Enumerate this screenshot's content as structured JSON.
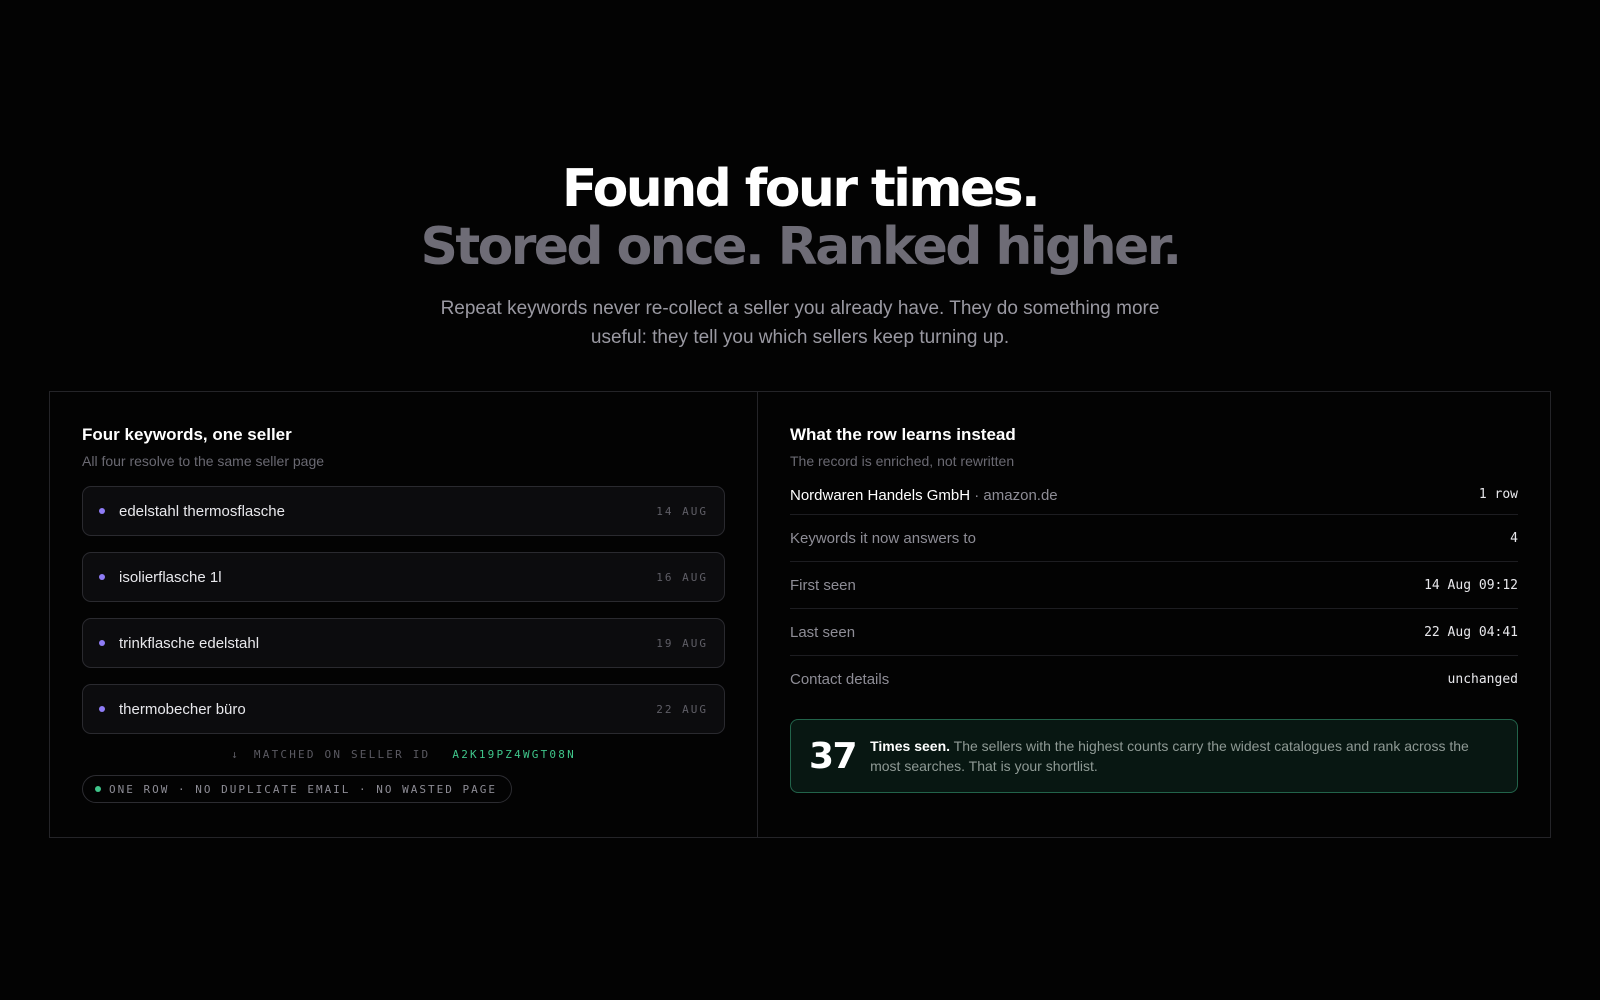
{
  "hero": {
    "headline_line1": "Found four times.",
    "headline_line2": "Stored once. Ranked higher.",
    "subtext": "Repeat keywords never re-collect a seller you already have. They do something more useful: they tell you which sellers keep turning up."
  },
  "left_panel": {
    "title": "Four keywords, one seller",
    "subtitle": "All four resolve to the same seller page",
    "keywords": [
      {
        "term": "edelstahl thermosflasche",
        "date": "14 AUG"
      },
      {
        "term": "isolierflasche 1l",
        "date": "16 AUG"
      },
      {
        "term": "trinkflasche edelstahl",
        "date": "19 AUG"
      },
      {
        "term": "thermobecher büro",
        "date": "22 AUG"
      }
    ],
    "matched_label": "MATCHED ON SELLER ID",
    "matched_arrow": "↓",
    "seller_id": "A2K19PZ4WGT08N",
    "summary_pill": "ONE ROW · NO DUPLICATE EMAIL · NO WASTED PAGE"
  },
  "right_panel": {
    "title": "What the row learns instead",
    "subtitle": "The record is enriched, not rewritten",
    "seller_name": "Nordwaren Handels GmbH",
    "seller_separator": " · ",
    "seller_domain": "amazon.de",
    "seller_value": "1 row",
    "rows": [
      {
        "label": "Keywords it now answers to",
        "value": "4"
      },
      {
        "label": "First seen",
        "value": "14 Aug 09:12"
      },
      {
        "label": "Last seen",
        "value": "22 Aug 04:41"
      },
      {
        "label": "Contact details",
        "value": "unchanged"
      }
    ],
    "callout": {
      "number": "37",
      "lead": "Times seen.",
      "body": " The sellers with the highest counts carry the widest catalogues and rank across the most searches. That is your shortlist."
    }
  },
  "colors": {
    "background": "#030303",
    "accent_purple": "#8f7cf6",
    "accent_green": "#3fc58a",
    "muted_headline": "#6e6c76"
  }
}
